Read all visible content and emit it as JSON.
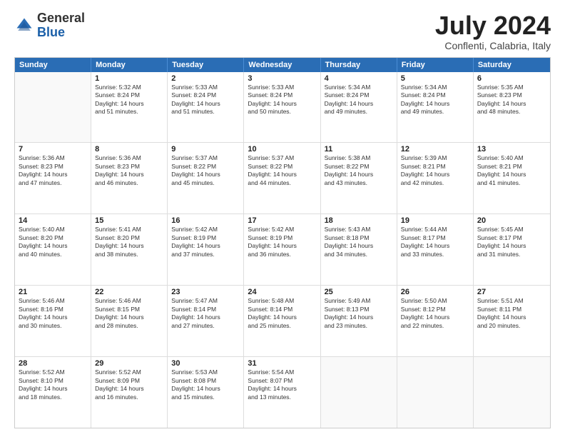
{
  "logo": {
    "general": "General",
    "blue": "Blue"
  },
  "header": {
    "month_year": "July 2024",
    "location": "Conflenti, Calabria, Italy"
  },
  "weekdays": [
    "Sunday",
    "Monday",
    "Tuesday",
    "Wednesday",
    "Thursday",
    "Friday",
    "Saturday"
  ],
  "rows": [
    [
      {
        "day": "",
        "info": ""
      },
      {
        "day": "1",
        "info": "Sunrise: 5:32 AM\nSunset: 8:24 PM\nDaylight: 14 hours\nand 51 minutes."
      },
      {
        "day": "2",
        "info": "Sunrise: 5:33 AM\nSunset: 8:24 PM\nDaylight: 14 hours\nand 51 minutes."
      },
      {
        "day": "3",
        "info": "Sunrise: 5:33 AM\nSunset: 8:24 PM\nDaylight: 14 hours\nand 50 minutes."
      },
      {
        "day": "4",
        "info": "Sunrise: 5:34 AM\nSunset: 8:24 PM\nDaylight: 14 hours\nand 49 minutes."
      },
      {
        "day": "5",
        "info": "Sunrise: 5:34 AM\nSunset: 8:24 PM\nDaylight: 14 hours\nand 49 minutes."
      },
      {
        "day": "6",
        "info": "Sunrise: 5:35 AM\nSunset: 8:23 PM\nDaylight: 14 hours\nand 48 minutes."
      }
    ],
    [
      {
        "day": "7",
        "info": "Sunrise: 5:36 AM\nSunset: 8:23 PM\nDaylight: 14 hours\nand 47 minutes."
      },
      {
        "day": "8",
        "info": "Sunrise: 5:36 AM\nSunset: 8:23 PM\nDaylight: 14 hours\nand 46 minutes."
      },
      {
        "day": "9",
        "info": "Sunrise: 5:37 AM\nSunset: 8:22 PM\nDaylight: 14 hours\nand 45 minutes."
      },
      {
        "day": "10",
        "info": "Sunrise: 5:37 AM\nSunset: 8:22 PM\nDaylight: 14 hours\nand 44 minutes."
      },
      {
        "day": "11",
        "info": "Sunrise: 5:38 AM\nSunset: 8:22 PM\nDaylight: 14 hours\nand 43 minutes."
      },
      {
        "day": "12",
        "info": "Sunrise: 5:39 AM\nSunset: 8:21 PM\nDaylight: 14 hours\nand 42 minutes."
      },
      {
        "day": "13",
        "info": "Sunrise: 5:40 AM\nSunset: 8:21 PM\nDaylight: 14 hours\nand 41 minutes."
      }
    ],
    [
      {
        "day": "14",
        "info": "Sunrise: 5:40 AM\nSunset: 8:20 PM\nDaylight: 14 hours\nand 40 minutes."
      },
      {
        "day": "15",
        "info": "Sunrise: 5:41 AM\nSunset: 8:20 PM\nDaylight: 14 hours\nand 38 minutes."
      },
      {
        "day": "16",
        "info": "Sunrise: 5:42 AM\nSunset: 8:19 PM\nDaylight: 14 hours\nand 37 minutes."
      },
      {
        "day": "17",
        "info": "Sunrise: 5:42 AM\nSunset: 8:19 PM\nDaylight: 14 hours\nand 36 minutes."
      },
      {
        "day": "18",
        "info": "Sunrise: 5:43 AM\nSunset: 8:18 PM\nDaylight: 14 hours\nand 34 minutes."
      },
      {
        "day": "19",
        "info": "Sunrise: 5:44 AM\nSunset: 8:17 PM\nDaylight: 14 hours\nand 33 minutes."
      },
      {
        "day": "20",
        "info": "Sunrise: 5:45 AM\nSunset: 8:17 PM\nDaylight: 14 hours\nand 31 minutes."
      }
    ],
    [
      {
        "day": "21",
        "info": "Sunrise: 5:46 AM\nSunset: 8:16 PM\nDaylight: 14 hours\nand 30 minutes."
      },
      {
        "day": "22",
        "info": "Sunrise: 5:46 AM\nSunset: 8:15 PM\nDaylight: 14 hours\nand 28 minutes."
      },
      {
        "day": "23",
        "info": "Sunrise: 5:47 AM\nSunset: 8:14 PM\nDaylight: 14 hours\nand 27 minutes."
      },
      {
        "day": "24",
        "info": "Sunrise: 5:48 AM\nSunset: 8:14 PM\nDaylight: 14 hours\nand 25 minutes."
      },
      {
        "day": "25",
        "info": "Sunrise: 5:49 AM\nSunset: 8:13 PM\nDaylight: 14 hours\nand 23 minutes."
      },
      {
        "day": "26",
        "info": "Sunrise: 5:50 AM\nSunset: 8:12 PM\nDaylight: 14 hours\nand 22 minutes."
      },
      {
        "day": "27",
        "info": "Sunrise: 5:51 AM\nSunset: 8:11 PM\nDaylight: 14 hours\nand 20 minutes."
      }
    ],
    [
      {
        "day": "28",
        "info": "Sunrise: 5:52 AM\nSunset: 8:10 PM\nDaylight: 14 hours\nand 18 minutes."
      },
      {
        "day": "29",
        "info": "Sunrise: 5:52 AM\nSunset: 8:09 PM\nDaylight: 14 hours\nand 16 minutes."
      },
      {
        "day": "30",
        "info": "Sunrise: 5:53 AM\nSunset: 8:08 PM\nDaylight: 14 hours\nand 15 minutes."
      },
      {
        "day": "31",
        "info": "Sunrise: 5:54 AM\nSunset: 8:07 PM\nDaylight: 14 hours\nand 13 minutes."
      },
      {
        "day": "",
        "info": ""
      },
      {
        "day": "",
        "info": ""
      },
      {
        "day": "",
        "info": ""
      }
    ]
  ]
}
